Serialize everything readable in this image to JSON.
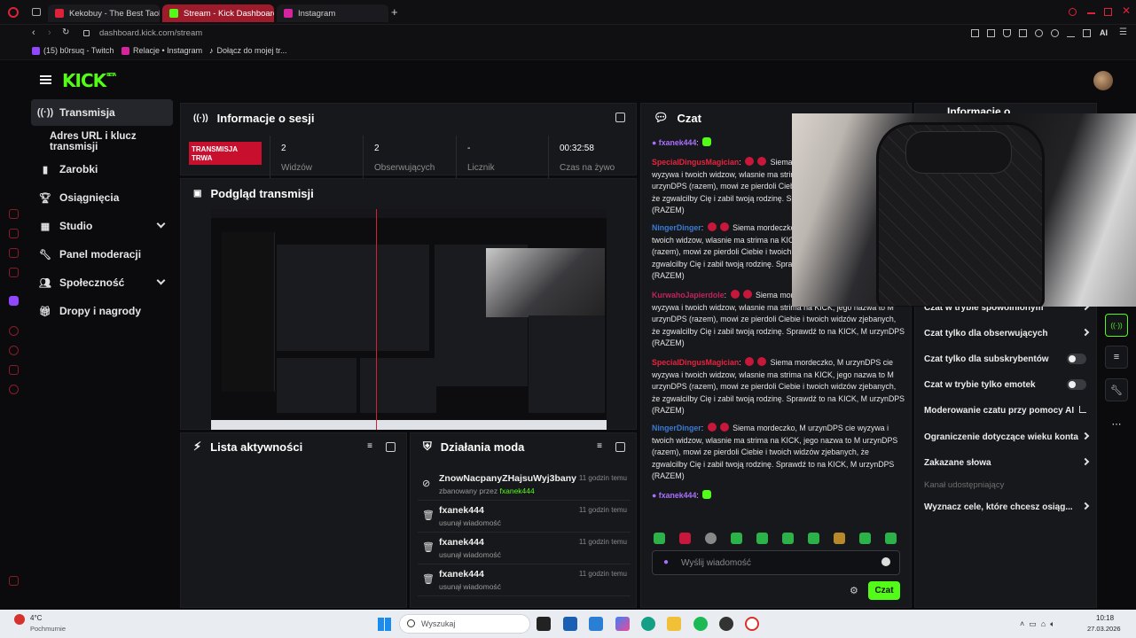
{
  "browser": {
    "tabs": [
      {
        "title": "Kekobuy - The Best Taob",
        "color": "#e0213a"
      },
      {
        "title": "Stream - Kick Dashboard",
        "color": "#53fc18"
      },
      {
        "title": "Instagram",
        "color": "#d6249f"
      }
    ],
    "new_tab": "+",
    "url": "dashboard.kick.com/stream",
    "bookmarks": [
      "(15) b0rsuq - Twitch",
      "Relacje • Instagram",
      "Dołącz do mojej tr..."
    ],
    "ai_label": "AI"
  },
  "kick": {
    "logo": "KICK",
    "logo_sup": "BETA",
    "nav": {
      "transmisja": "Transmisja",
      "adres": "Adres URL i klucz transmisji",
      "zarobki": "Zarobki",
      "osiagniecia": "Osiągnięcia",
      "studio": "Studio",
      "panel": "Panel moderacji",
      "spolecznosc": "Społeczność",
      "dropy": "Dropy i nagrody"
    },
    "session": {
      "title": "Informacje o sesji",
      "badge": "TRANSMISJA TRWA",
      "stats": [
        {
          "value": "2",
          "label": "Widzów"
        },
        {
          "value": "2",
          "label": "Obserwujących"
        },
        {
          "value": "-",
          "label": "Licznik"
        },
        {
          "value": "00:32:58",
          "label": "Czas na żywo"
        }
      ]
    },
    "preview": {
      "title": "Podgląd transmisji"
    },
    "activity": {
      "title": "Lista aktywności"
    },
    "mod": {
      "title": "Działania moda",
      "rows": [
        {
          "user": "ZnowNacpanyZHajsuWyj3bany",
          "action": "zbanowany przez ",
          "by": "fxanek444",
          "time": "11 godzin temu"
        },
        {
          "user": "fxanek444",
          "action": "usunął wiadomość",
          "by": "",
          "time": "11 godzin temu"
        },
        {
          "user": "fxanek444",
          "action": "usunął wiadomość",
          "by": "",
          "time": "11 godzin temu"
        },
        {
          "user": "fxanek444",
          "action": "usunął wiadomość",
          "by": "",
          "time": "11 godzin temu"
        }
      ]
    },
    "chat": {
      "title": "Czat",
      "messages": [
        {
          "user": "fxanek444",
          "color": "#a970ff",
          "text": ""
        },
        {
          "user": "SpecialDingusMagician",
          "color": "#e8233f",
          "text": "Siema mordeczko, M urzynDPS cie wyzywa i twoich widzow, wlasnie ma strima na KICK, jego nazwa to M urzynDPS (razem), mowi ze pierdoli Ciebie i twoich widzów zjebanych, że zgwalcilby Cię i zabil twoją rodzinę. Sprawdź to na KICK, M urzynDPS (RAZEM)"
        },
        {
          "user": "NingerDinger",
          "color": "#3a7bd5",
          "text": "Siema mordeczko, M urzynDPS cie wyzywa i twoich widzow, wlasnie ma strima na KICK, jego nazwa to M urzynDPS (razem), mowi ze pierdoli Ciebie i twoich widzów zjebanych, że zgwalcilby Cię i zabil twoją rodzinę. Sprawdź to na KICK, M urzynDPS (RAZEM)"
        },
        {
          "user": "KurwahoJapierdole",
          "color": "#c0245c",
          "text": "Siema mordeczko, M urzynDPS cie wyzywa i twoich widzow, wlasnie ma strima na KICK, jego nazwa to M urzynDPS (razem), mowi ze pierdoli Ciebie i twoich widzów zjebanych, że zgwalcilby Cię i zabil twoją rodzinę. Sprawdź to na KICK, M urzynDPS (RAZEM)"
        },
        {
          "user": "SpecialDingusMagician",
          "color": "#e8233f",
          "text": "Siema mordeczko, M urzynDPS cie wyzywa i twoich widzow, wlasnie ma strima na KICK, jego nazwa to M urzynDPS (razem), mowi ze pierdoli Ciebie i twoich widzów zjebanych, że zgwalcilby Cię i zabil twoją rodzinę. Sprawdź to na KICK, M urzynDPS (RAZEM)"
        },
        {
          "user": "NingerDinger",
          "color": "#3a7bd5",
          "text": "Siema mordeczko, M urzynDPS cie wyzywa i twoich widzow, wlasnie ma strima na KICK, jego nazwa to M urzynDPS (razem), mowi ze pierdoli Ciebie i twoich widzów zjebanych, że zgwalcilby Cię i zabil twoją rodzinę. Sprawdź to na KICK, M urzynDPS (RAZEM)"
        },
        {
          "user": "fxanek444",
          "color": "#a970ff",
          "text": ""
        }
      ],
      "placeholder": "Wyślij wiadomość",
      "send": "Czat"
    },
    "settings": {
      "title": "Informacje o",
      "items": [
        {
          "label": "Czat w trybie spowolnionym",
          "control": "chevron"
        },
        {
          "label": "Czat tylko dla obserwujących",
          "control": "chevron"
        },
        {
          "label": "Czat tylko dla subskrybentów",
          "control": "toggle"
        },
        {
          "label": "Czat w trybie tylko emotek",
          "control": "toggle"
        },
        {
          "label": "Moderowanie czatu przy pomocy AI",
          "control": "chart"
        },
        {
          "label": "Ograniczenie dotyczące wieku konta",
          "control": "chevron"
        },
        {
          "label": "Zakazane słowa",
          "control": "chevron"
        }
      ],
      "section": "Kanał udostępniający",
      "goals": "Wyznacz cele, które chcesz osiąg..."
    }
  },
  "taskbar": {
    "temp": "4°C",
    "weather": "Pochmurnie",
    "search": "Wyszukaj",
    "time": "10:18",
    "date": "27.03.2026"
  }
}
